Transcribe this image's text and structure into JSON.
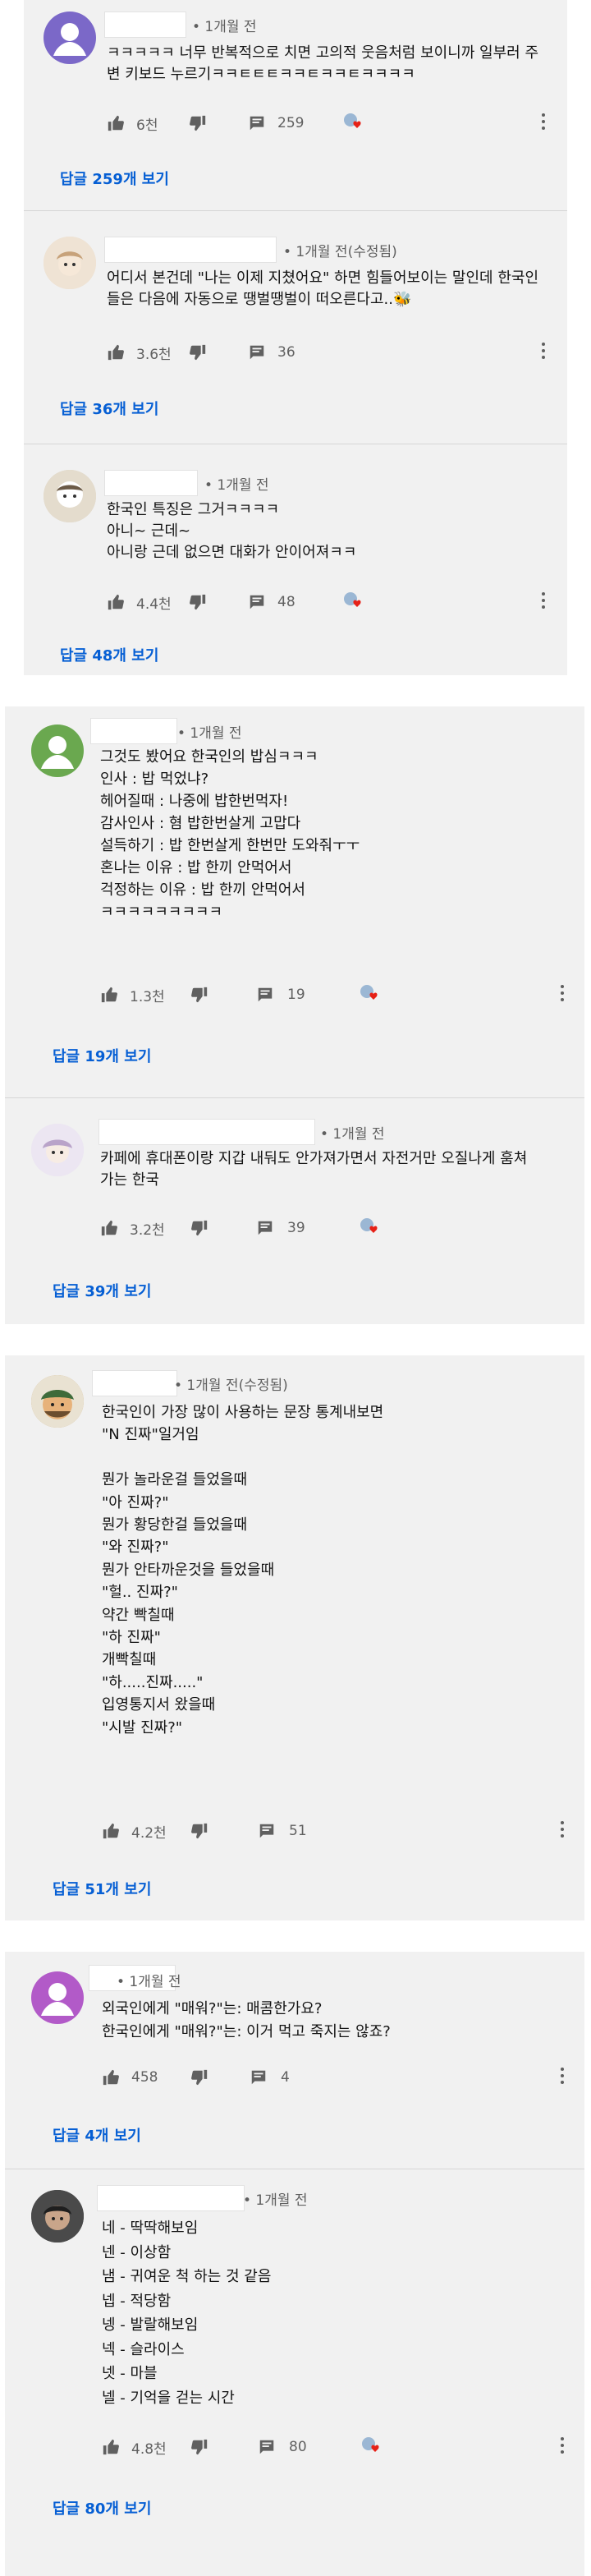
{
  "cards": [
    {
      "comments": [
        {
          "time": "• 1개월 전",
          "body": "ㅋㅋㅋㅋㅋ 너무 반복적으로 치면 고의적 웃음처럼 보이니까 일부러 주\n변 키보드 누르기ㅋㅋㅌㅌㅌㅋㅋㅌㅋㅋㅌㅋㅋㅋㅋ",
          "likes": "6천",
          "replies": "259",
          "reply_label": "답글 259개 보기"
        },
        {
          "time": "• 1개월 전(수정됨)",
          "body": "어디서 본건데 \"나는 이제 지쳤어요\" 하면 힘들어보이는 말인데 한국인\n들은 다음에 자동으로 땡벌땡벌이 떠오른다고..🐝",
          "likes": "3.6천",
          "replies": "36",
          "reply_label": "답글 36개 보기"
        },
        {
          "time": "• 1개월 전",
          "body": "한국인 특징은 그거ㅋㅋㅋㅋ\n아니~ 근데~\n아니랑 근데 없으면 대화가 안이어져ㅋㅋ",
          "likes": "4.4천",
          "replies": "48",
          "reply_label": "답글 48개 보기"
        }
      ]
    },
    {
      "comments": [
        {
          "time": "• 1개월 전",
          "body": "그것도 봤어요 한국인의 밥심ㅋㅋㅋ\n인사 : 밥 먹었냐?\n헤어질때 : 나중에 밥한번먹자!\n감사인사 : 혐 밥한번살게 고맙다\n설득하기 : 밥 한번살게 한번만 도와줘ㅜㅜ\n혼나는 이유 : 밥 한끼 안먹어서\n걱정하는 이유 : 밥 한끼 안먹어서\nㅋㅋㅋㅋㅋㅋㅋㅋㅋ",
          "likes": "1.3천",
          "replies": "19",
          "reply_label": "답글 19개 보기"
        },
        {
          "time": "• 1개월 전",
          "body": "카페에 휴대폰이랑 지갑 내둬도 안가져가면서 자전거만 오질나게 훔쳐\n가는 한국",
          "likes": "3.2천",
          "replies": "39",
          "reply_label": "답글 39개 보기"
        }
      ]
    },
    {
      "comments": [
        {
          "time": "• 1개월 전(수정됨)",
          "body": "한국인이 가장 많이 사용하는 문장 통계내보면\n\"N 진짜\"일거임\n\n뭔가 놀라운걸 들었을때\n\"아 진짜?\"\n뭔가 황당한걸 들었을때\n\"와 진짜?\"\n뭔가 안타까운것을 들었을때\n\"헐.. 진짜?\"\n약간 빡칠때\n\"하 진짜\"\n개빡칠때\n\"하.....진짜.....\"\n입영통지서 왔을때\n\"시발 진짜?\"",
          "likes": "4.2천",
          "replies": "51",
          "reply_label": "답글 51개 보기"
        }
      ]
    },
    {
      "comments": [
        {
          "time": "• 1개월 전",
          "body": "외국인에게 \"매워?\"는: 매콤한가요?\n한국인에게 \"매워?\"는: 이거 먹고 죽지는 않죠?",
          "likes": "458",
          "replies": "4",
          "reply_label": "답글 4개 보기"
        },
        {
          "time": "• 1개월 전",
          "body": "네 - 딱딱해보임\n넨 - 이상함\n냄 - 귀여운 척 하는 것 같음\n넵 - 적당함\n넹 - 발랄해보임\n넥 - 슬라이스\n넷 - 마블\n넬 - 기억을 걷는 시간",
          "likes": "4.8천",
          "replies": "80",
          "reply_label": "답글 80개 보기"
        }
      ]
    }
  ],
  "icons": {
    "like": "thumbs-up-icon",
    "dislike": "thumbs-down-icon",
    "reply": "comment-icon",
    "heart": "creator-heart-icon",
    "more": "more-vert-icon"
  },
  "colors": {
    "card_bg": "#f1f1f1",
    "reply_link": "#065fd4",
    "heart": "#e62117"
  }
}
